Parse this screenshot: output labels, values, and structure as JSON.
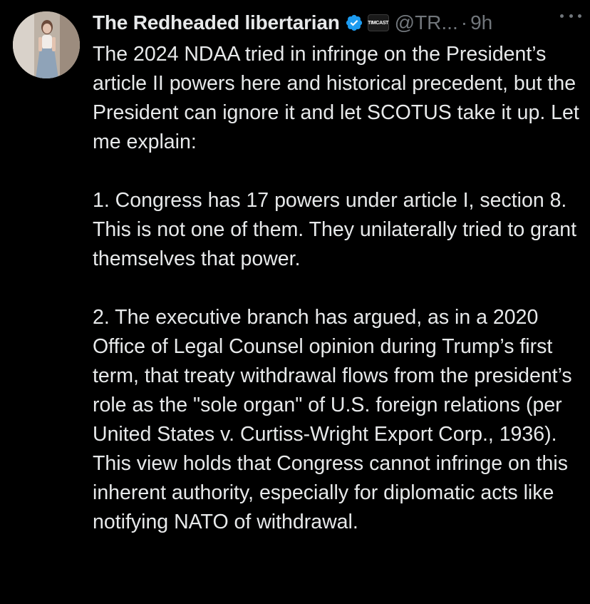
{
  "author": {
    "display_name": "The Redheaded libertarian",
    "affiliate_badge": "TIMCAST",
    "handle": "@TR...",
    "separator": "·",
    "time": "9h",
    "verified_color": "#1d9bf0"
  },
  "icons": {
    "verified": "verified-badge-icon",
    "more": "more-options-icon"
  },
  "tweet": {
    "paragraphs": [
      "The 2024 NDAA tried in infringe on the President’s article II powers here and historical precedent, but the President can ignore it and let SCOTUS take it up. Let me explain:",
      "1. Congress has 17 powers under article I, section 8. This is not one of them. They unilaterally tried to grant themselves that power.",
      "2. The executive branch has argued, as in a 2020 Office of Legal Counsel opinion during Trump’s first term, that treaty withdrawal flows from the president’s role as the \"sole organ\" of U.S. foreign relations (per United States v. Curtiss-Wright Export Corp., 1936). This view holds that Congress cannot infringe on this inherent authority, especially for diplomatic acts like notifying NATO of withdrawal."
    ]
  }
}
